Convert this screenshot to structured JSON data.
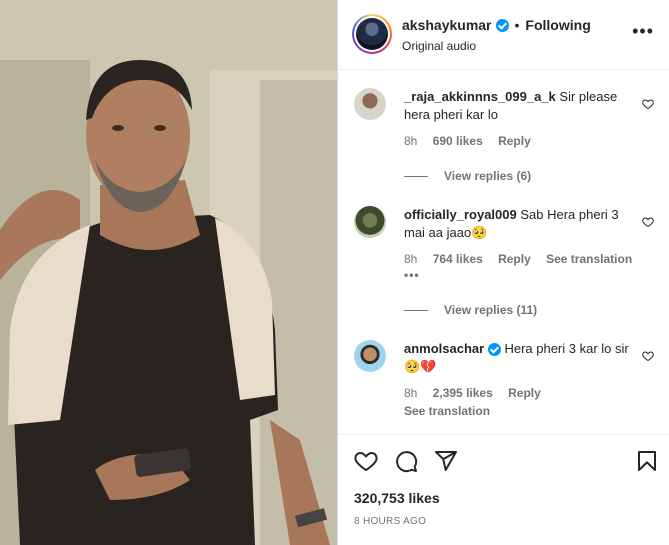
{
  "post": {
    "username": "akshaykumar",
    "separator": "•",
    "follow_status": "Following",
    "audio": "Original audio",
    "more_label": "•••"
  },
  "comments": [
    {
      "username": "_raja_akkinnns_099_a_k",
      "text": "Sir please hera pheri kar lo",
      "age": "8h",
      "likes": "690 likes",
      "reply": "Reply",
      "view_replies": "View replies (6)"
    },
    {
      "username": "officially_royal009",
      "text": "Sab Hera pheri 3 mai aa jaao🥺",
      "age": "8h",
      "likes": "764 likes",
      "reply": "Reply",
      "translation": "See translation",
      "more": "•••",
      "view_replies": "View replies (11)"
    },
    {
      "username": "anmolsachar",
      "verified": true,
      "text": "Hera pheri 3 kar lo sir🥺💔",
      "age": "8h",
      "likes": "2,395 likes",
      "reply": "Reply",
      "translation": "See translation"
    }
  ],
  "footer": {
    "likes": "320,753 likes",
    "time": "8 HOURS AGO",
    "icons": [
      "heart-icon",
      "comment-icon",
      "share-icon",
      "bookmark-icon"
    ]
  },
  "colors": {
    "accent": "#0095f6",
    "text": "#262626",
    "muted": "#737373"
  }
}
